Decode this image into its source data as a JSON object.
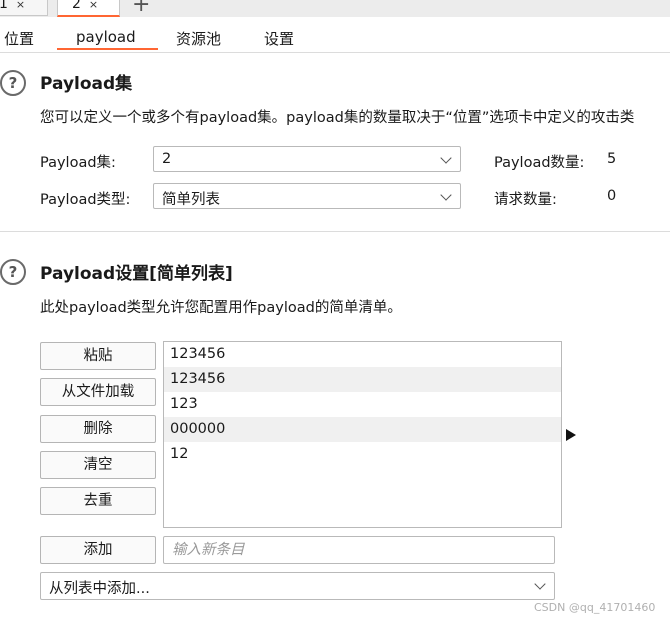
{
  "tabs": [
    {
      "label": "1",
      "close": "×"
    },
    {
      "label": "2",
      "close": "×"
    }
  ],
  "new_tab": "+",
  "subtabs": [
    "位置",
    "payload",
    "资源池",
    "设置"
  ],
  "sets_section": {
    "help": "?",
    "title": "Payload集",
    "description": "您可以定义一个或多个有payload集。payload集的数量取决于“位置”选项卡中定义的攻击类",
    "set_label": "Payload集:",
    "set_value": "2",
    "type_label": "Payload类型:",
    "type_value": "简单列表",
    "count_label": "Payload数量:",
    "count_value": "5",
    "request_label": "请求数量:",
    "request_value": "0"
  },
  "settings_section": {
    "help": "?",
    "title": "Payload设置[简单列表]",
    "description": "此处payload类型允许您配置用作payload的简单清单。",
    "buttons": {
      "paste": "粘贴",
      "load": "从文件加载",
      "remove": "删除",
      "clear": "清空",
      "dedupe": "去重",
      "add": "添加"
    },
    "items": [
      "123456",
      "123456",
      "123",
      "000000",
      "12"
    ],
    "new_item_placeholder": "输入新条目",
    "add_from_list": "从列表中添加..."
  },
  "watermark": "CSDN @qq_41701460"
}
